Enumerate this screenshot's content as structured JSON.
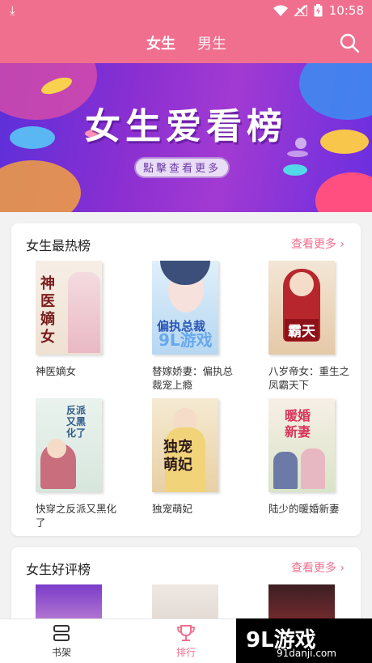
{
  "status": {
    "time": "10:58"
  },
  "header": {
    "tabs": [
      {
        "label": "女生"
      },
      {
        "label": "男生"
      }
    ]
  },
  "banner": {
    "title": "女生爱看榜",
    "button": "點擊查看更多"
  },
  "section1": {
    "title": "女生最热榜",
    "more": "查看更多 ›",
    "books": [
      {
        "title": "神医嫡女",
        "cover_text": "神医嫡女"
      },
      {
        "title": "替嫁娇妻：偏执总裁宠上瘾",
        "cover_text": "偏执总裁"
      },
      {
        "title": "八岁帝女：重生之凤霸天下",
        "cover_text": "霸天"
      },
      {
        "title": "快穿之反派又黑化了",
        "cover_text": "反派又黑化了"
      },
      {
        "title": "独宠萌妃",
        "cover_text": "独宠萌妃"
      },
      {
        "title": "陆少的暖婚新妻",
        "cover_text": "暖婚新妻"
      }
    ]
  },
  "section2": {
    "title": "女生好评榜",
    "more": "查看更多 ›"
  },
  "nav": {
    "shelf": "书架",
    "rank": "排行"
  },
  "watermark": {
    "logo": "9L游戏",
    "url": "91danji.com",
    "mid_logo": "9L游戏"
  },
  "colors": {
    "accent": "#f06f8f",
    "banner": "#8a2fd1"
  }
}
